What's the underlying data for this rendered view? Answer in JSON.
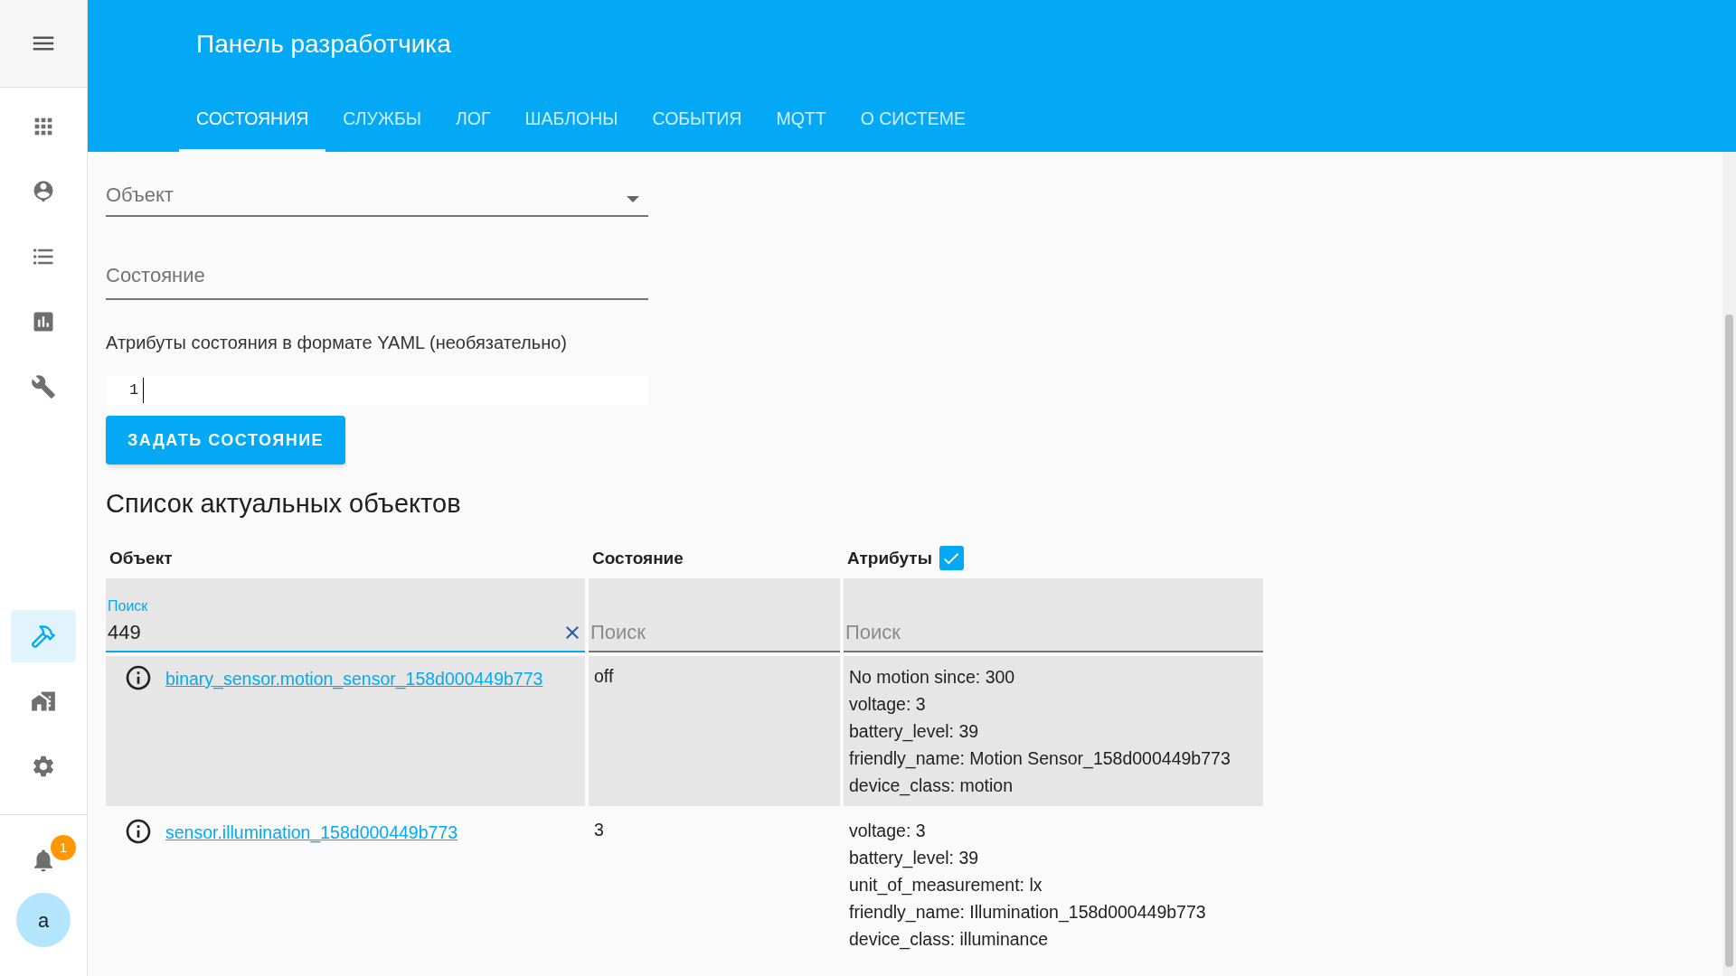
{
  "sidebar": {
    "top_items": [
      {
        "selected": false
      },
      {
        "selected": false
      },
      {
        "selected": false
      },
      {
        "selected": false
      },
      {
        "selected": false
      }
    ],
    "bottom_items": [
      {
        "selected": true
      },
      {
        "selected": false
      },
      {
        "selected": false
      }
    ],
    "notifications_badge": "1",
    "user_avatar": "a"
  },
  "header": {
    "title": "Панель разработчика"
  },
  "tabs": [
    {
      "label": "СОСТОЯНИЯ",
      "selected": true
    },
    {
      "label": "СЛУЖБЫ",
      "selected": false
    },
    {
      "label": "ЛОГ",
      "selected": false
    },
    {
      "label": "ШАБЛОНЫ",
      "selected": false
    },
    {
      "label": "СОБЫТИЯ",
      "selected": false
    },
    {
      "label": "MQTT",
      "selected": false
    },
    {
      "label": "О СИСТЕМЕ",
      "selected": false
    }
  ],
  "form": {
    "entity_field": {
      "placeholder": "Объект"
    },
    "state_field": {
      "placeholder": "Состояние"
    },
    "attributes_label": "Атрибуты состояния в формате YAML (необязательно)",
    "editor_line_number": "1",
    "submit_button": "ЗАДАТЬ СОСТОЯНИЕ"
  },
  "entities": {
    "title": "Список актуальных объектов",
    "columns": [
      "Объект",
      "Состояние",
      "Атрибуты"
    ],
    "attributes_checkbox": {
      "checked": true
    },
    "filters": [
      {
        "label": "Поиск",
        "value": "449"
      },
      {
        "placeholder": "Поиск"
      },
      {
        "placeholder": "Поиск"
      }
    ],
    "rows": [
      {
        "entity": "binary_sensor.motion_sensor_158d000449b773",
        "state": "off",
        "attributes": [
          "No motion since: 300",
          "voltage: 3",
          "battery_level: 39",
          "friendly_name: Motion Sensor_158d000449b773",
          "device_class: motion"
        ]
      },
      {
        "entity": "sensor.illumination_158d000449b773",
        "state": "3",
        "attributes": [
          "voltage: 3",
          "battery_level: 39",
          "unit_of_measurement: lx",
          "friendly_name: Illumination_158d000449b773",
          "device_class: illuminance"
        ]
      }
    ]
  }
}
